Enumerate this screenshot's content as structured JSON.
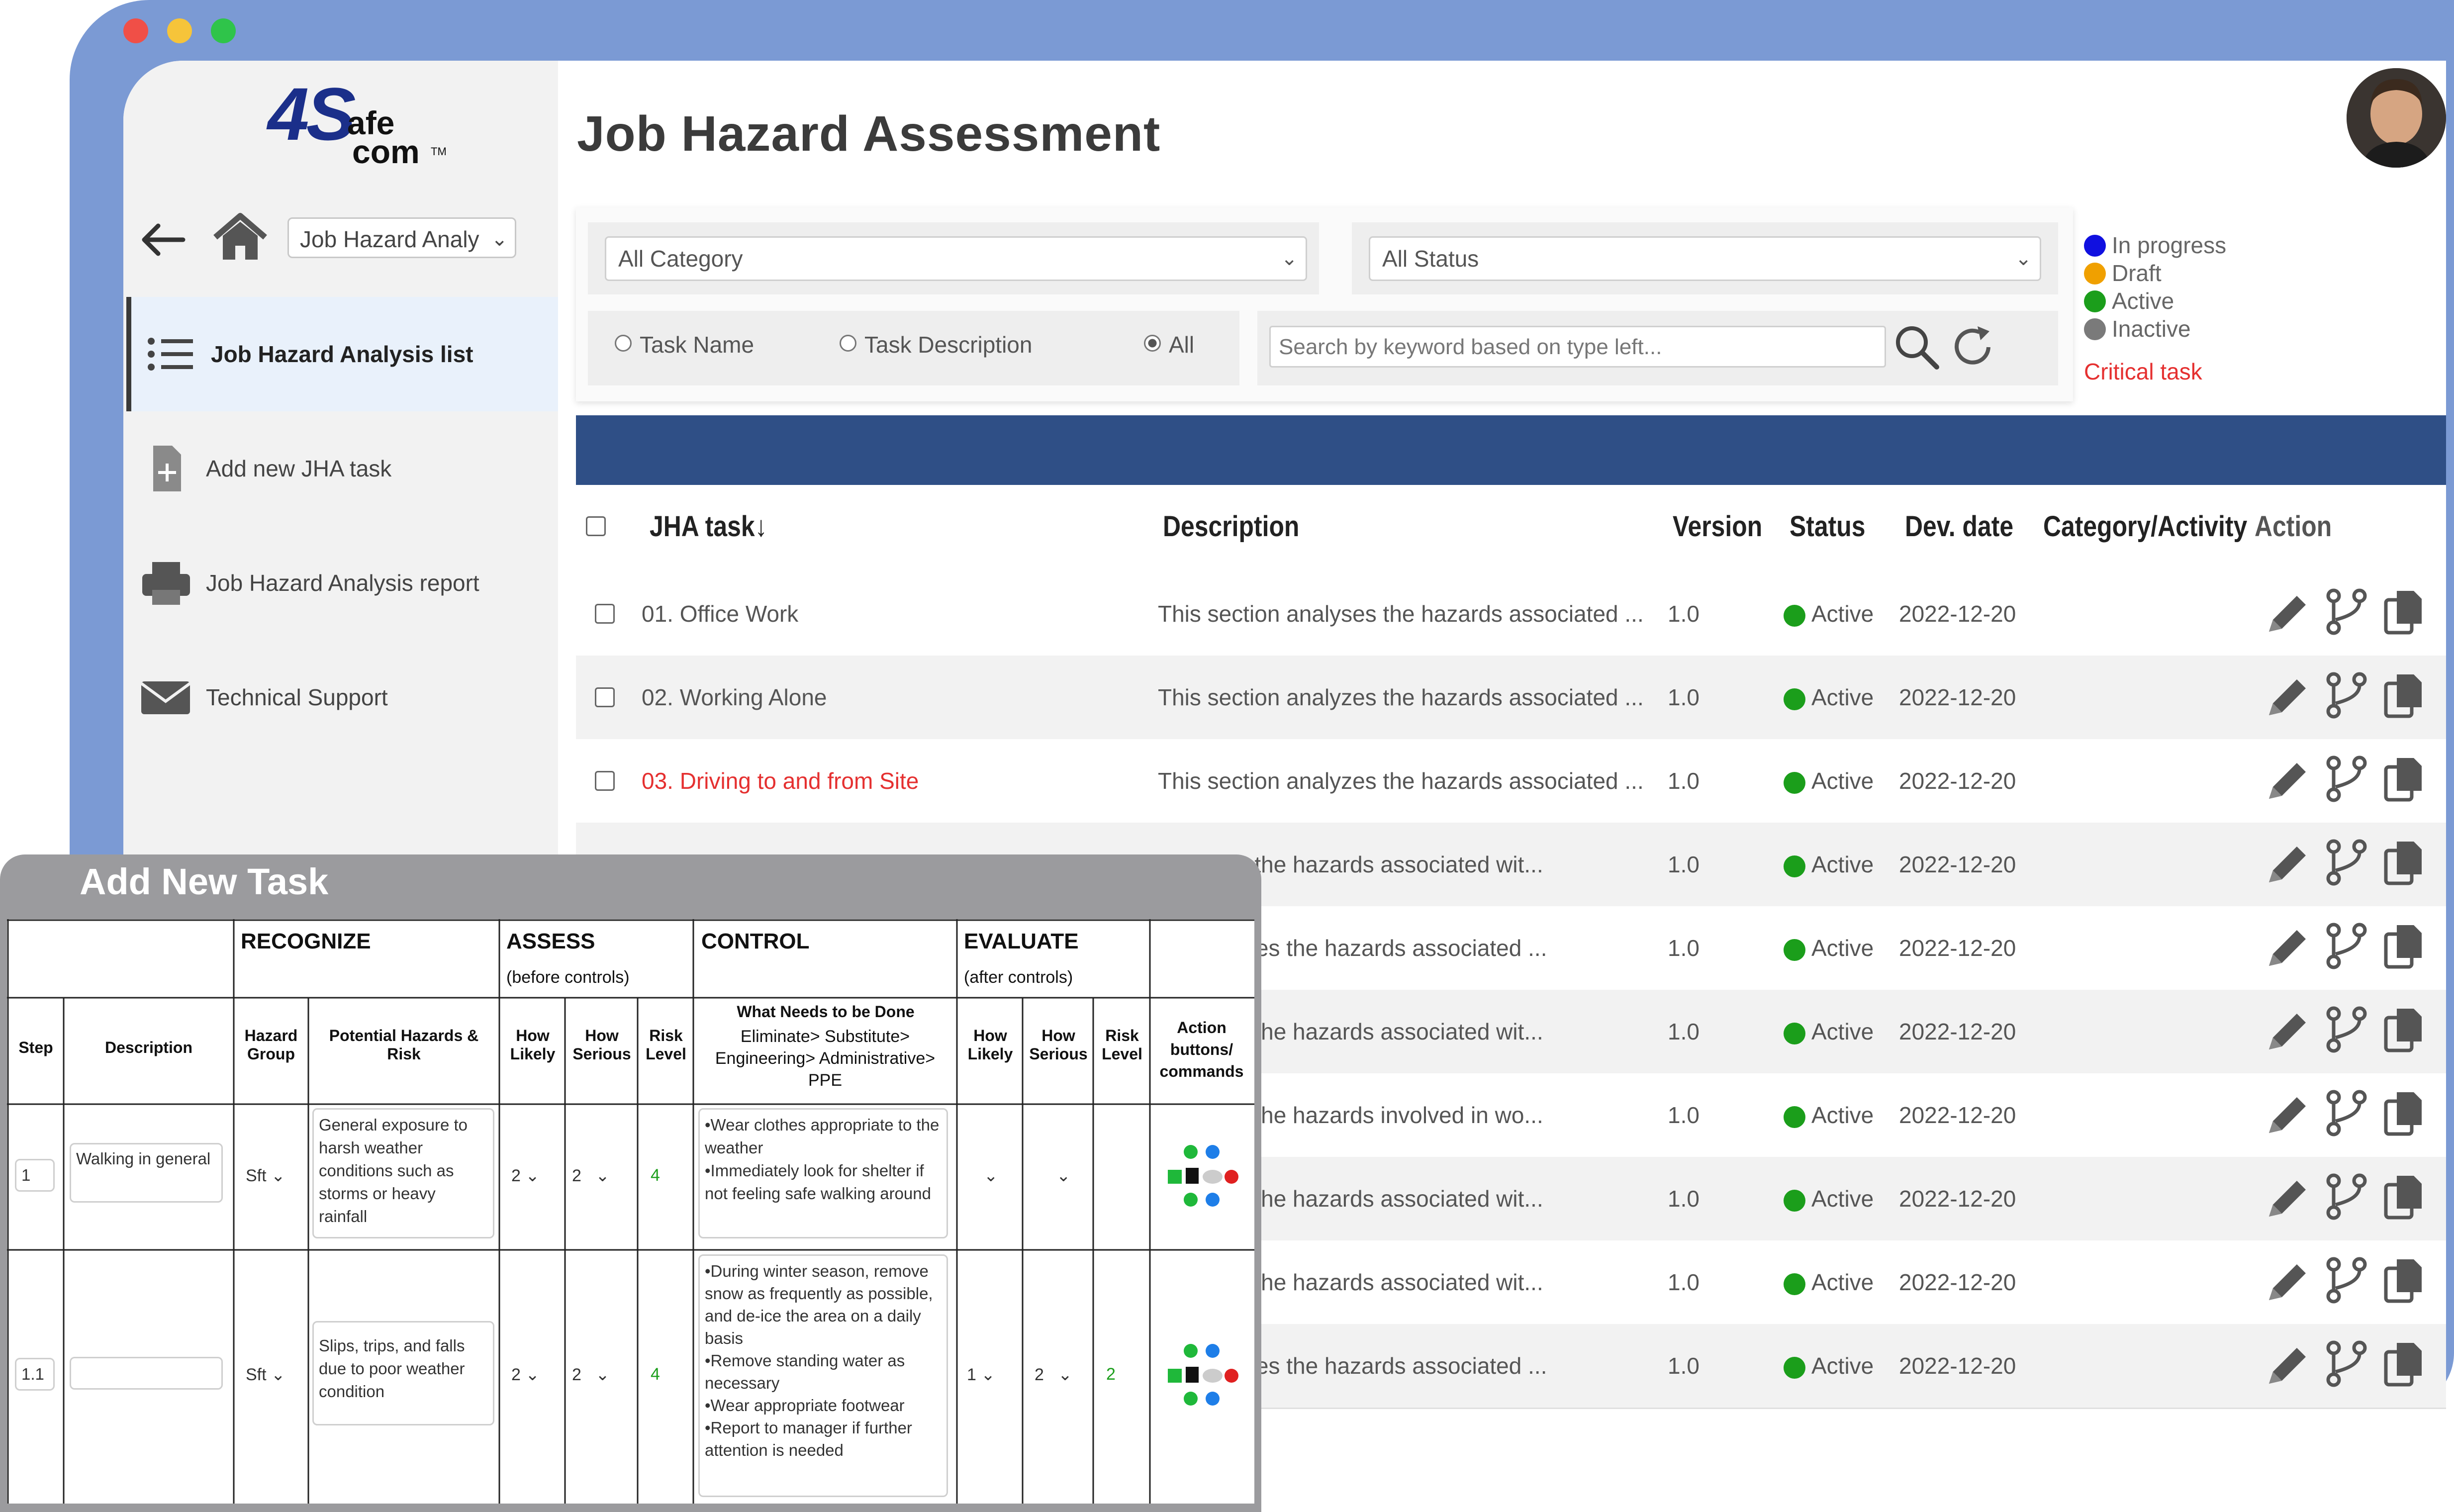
{
  "window": {
    "controls": [
      "close",
      "minimize",
      "maximize"
    ],
    "colors": {
      "close": "#f04f47",
      "minimize": "#f6c43a",
      "maximize": "#2fc44a",
      "frame": "#7b9ad4",
      "header_band": "#2f4f86"
    }
  },
  "logo": {
    "big": "4S",
    "top": "afe",
    "bottom": "com",
    "tm": "TM"
  },
  "nav": {
    "select_value": "Job Hazard Analy"
  },
  "sidebar": {
    "items": [
      {
        "label": "Job Hazard Analysis list",
        "icon": "list-icon",
        "active": true
      },
      {
        "label": "Add new JHA task",
        "icon": "add-document-icon"
      },
      {
        "label": "Job Hazard Analysis report",
        "icon": "printer-icon"
      },
      {
        "label": "Technical Support",
        "icon": "envelope-icon"
      }
    ]
  },
  "page": {
    "title": "Job Hazard Assessment"
  },
  "filters": {
    "category": "All Category",
    "status": "All Status",
    "radios": [
      "Task Name",
      "Task Description",
      "All"
    ],
    "selected_radio": "All",
    "search_placeholder": "Search by keyword based on type left..."
  },
  "legend": {
    "items": [
      {
        "label": "In progress",
        "color": "#1010e0"
      },
      {
        "label": "Draft",
        "color": "#f0a000"
      },
      {
        "label": "Active",
        "color": "#1b9e1b"
      },
      {
        "label": "Inactive",
        "color": "#7a7a7a"
      }
    ],
    "critical": "Critical task"
  },
  "table": {
    "columns": [
      "JHA task",
      "Description",
      "Version",
      "Status",
      "Dev. date",
      "Category/Activity",
      "Action"
    ],
    "sort_arrow": "↓",
    "rows": [
      {
        "task": "01. Office Work",
        "desc": "This section analyses the hazards associated ...",
        "version": "1.0",
        "status": "Active",
        "date": "2022-12-20",
        "critical": false
      },
      {
        "task": "02. Working Alone",
        "desc": "This section analyzes the hazards associated ...",
        "version": "1.0",
        "status": "Active",
        "date": "2022-12-20",
        "critical": false
      },
      {
        "task": "03. Driving to and from Site",
        "desc": "This section analyzes the hazards associated ...",
        "version": "1.0",
        "status": "Active",
        "date": "2022-12-20",
        "critical": true
      },
      {
        "task": "",
        "desc": "analyzes the hazards associated wit...",
        "version": "1.0",
        "status": "Active",
        "date": "2022-12-20"
      },
      {
        "task": "",
        "desc": "on analyzes the hazards associated ...",
        "version": "1.0",
        "status": "Active",
        "date": "2022-12-20"
      },
      {
        "task": "",
        "desc": "analyzes the hazards associated wit...",
        "version": "1.0",
        "status": "Active",
        "date": "2022-12-20"
      },
      {
        "task": "",
        "desc": "analyzes the hazards involved in wo...",
        "version": "1.0",
        "status": "Active",
        "date": "2022-12-20"
      },
      {
        "task": "",
        "desc": "analyzes the hazards associated wit...",
        "version": "1.0",
        "status": "Active",
        "date": "2022-12-20"
      },
      {
        "task": "",
        "desc": "analyzes the hazards associated wit...",
        "version": "1.0",
        "status": "Active",
        "date": "2022-12-20"
      },
      {
        "task": "",
        "desc": "on analyzes the hazards associated ...",
        "version": "1.0",
        "status": "Active",
        "date": "2022-12-20"
      }
    ]
  },
  "overlay": {
    "title": "Add New Task",
    "groups": {
      "recognize": "RECOGNIZE",
      "assess": "ASSESS",
      "assess_sub": "(before controls)",
      "control": "CONTROL",
      "evaluate": "EVALUATE",
      "evaluate_sub": "(after controls)"
    },
    "cols": {
      "step": "Step",
      "description": "Description",
      "hazard_group": "Hazard Group",
      "potential": "Potential Hazards & Risk",
      "how_likely": "How Likely",
      "how_serious": "How Serious",
      "risk_level": "Risk Level",
      "what_needs": "What Needs to be Done",
      "what_needs_sub": "Eliminate> Substitute> Engineering> Administrative> PPE",
      "action": "Action buttons/ commands"
    },
    "rows": [
      {
        "step": "1",
        "description": "Walking in general",
        "hazard_group": "Sft",
        "potential": "General exposure to harsh weather conditions such as storms or heavy rainfall",
        "likely": "2",
        "serious": "2",
        "risk": "4",
        "control": "•Wear clothes appropriate to the weather\n•Immediately look for shelter if not feeling safe walking around",
        "e_likely": "",
        "e_serious": "",
        "e_risk": ""
      },
      {
        "step": "1.1",
        "description": "",
        "hazard_group": "Sft",
        "potential": "Slips, trips, and falls due to poor weather condition",
        "likely": "2",
        "serious": "2",
        "risk": "4",
        "control": "•During winter season, remove snow as frequently as possible, and de-ice the area on a daily basis\n•Remove standing water as necessary\n•Wear appropriate footwear\n•Report to manager if further attention is needed",
        "e_likely": "1",
        "e_serious": "2",
        "e_risk": "2"
      }
    ]
  }
}
